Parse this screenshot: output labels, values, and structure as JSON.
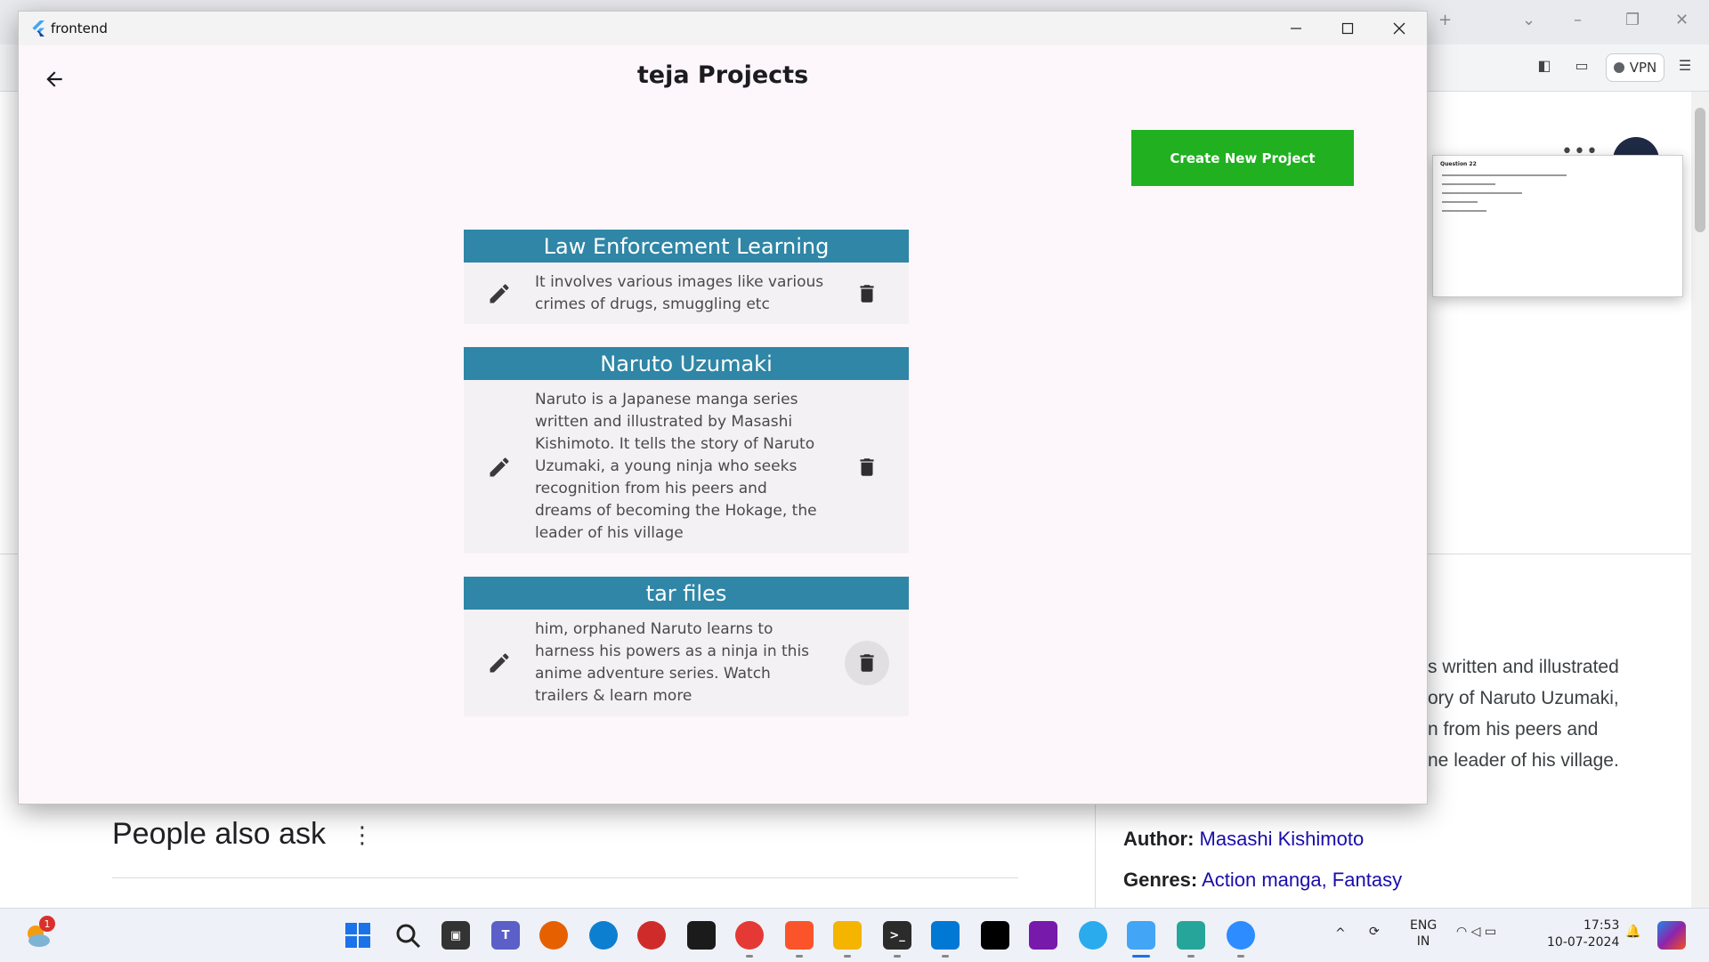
{
  "app": {
    "window_title": "frontend",
    "page_title": "teja Projects",
    "create_button": "Create New Project"
  },
  "projects": [
    {
      "title": "Law Enforcement Learning",
      "description": "It involves various images like various crimes of drugs, smuggling etc"
    },
    {
      "title": "Naruto Uzumaki",
      "description": "Naruto is a Japanese manga series written and illustrated by Masashi Kishimoto. It tells the story of Naruto Uzumaki, a young ninja who seeks recognition from his peers and dreams of becoming the Hokage, the leader of his village"
    },
    {
      "title": "tar files",
      "description": "him, orphaned Naruto learns to harness his powers as a ninja in this anime adventure series. Watch trailers & learn more"
    }
  ],
  "background": {
    "vpn_label": "VPN",
    "popup_question": "Question 22",
    "snippet_lines": [
      "s written and illustrated",
      "ory of Naruto Uzumaki,",
      "n from his peers and",
      "ne leader of his village."
    ],
    "people_also_ask": "People also ask",
    "author_label": "Author:",
    "author_value": "Masashi Kishimoto",
    "genres_label": "Genres:",
    "genres_value": "Action manga, Fantasy"
  },
  "taskbar": {
    "notification_count": "1",
    "lang_line1": "ENG",
    "lang_line2": "IN",
    "time": "17:53",
    "date": "10-07-2024"
  },
  "colors": {
    "card_header": "#2f86a6",
    "create_button": "#20b020",
    "window_bg": "#fdf7fb",
    "card_bg": "#f4f1f4"
  }
}
